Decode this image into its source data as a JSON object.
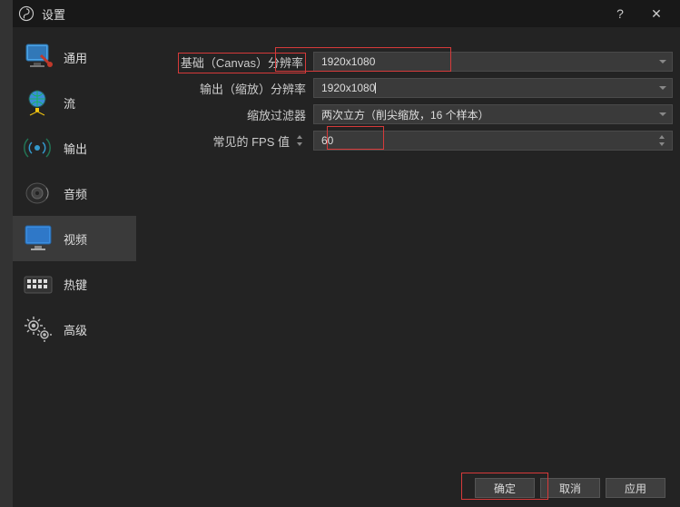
{
  "title": "设置",
  "sidebar": {
    "items": [
      {
        "label": "通用"
      },
      {
        "label": "流"
      },
      {
        "label": "输出"
      },
      {
        "label": "音频"
      },
      {
        "label": "视频"
      },
      {
        "label": "热键"
      },
      {
        "label": "高级"
      }
    ]
  },
  "form": {
    "base_res_label": "基础（Canvas）分辨率",
    "base_res_value": "1920x1080",
    "output_res_label": "输出（缩放）分辨率",
    "output_res_value": "1920x1080",
    "filter_label": "缩放过滤器",
    "filter_value": "两次立方（削尖缩放，16 个样本）",
    "fps_label": "常见的 FPS 值",
    "fps_value": "60"
  },
  "buttons": {
    "ok": "确定",
    "cancel": "取消",
    "apply": "应用"
  }
}
